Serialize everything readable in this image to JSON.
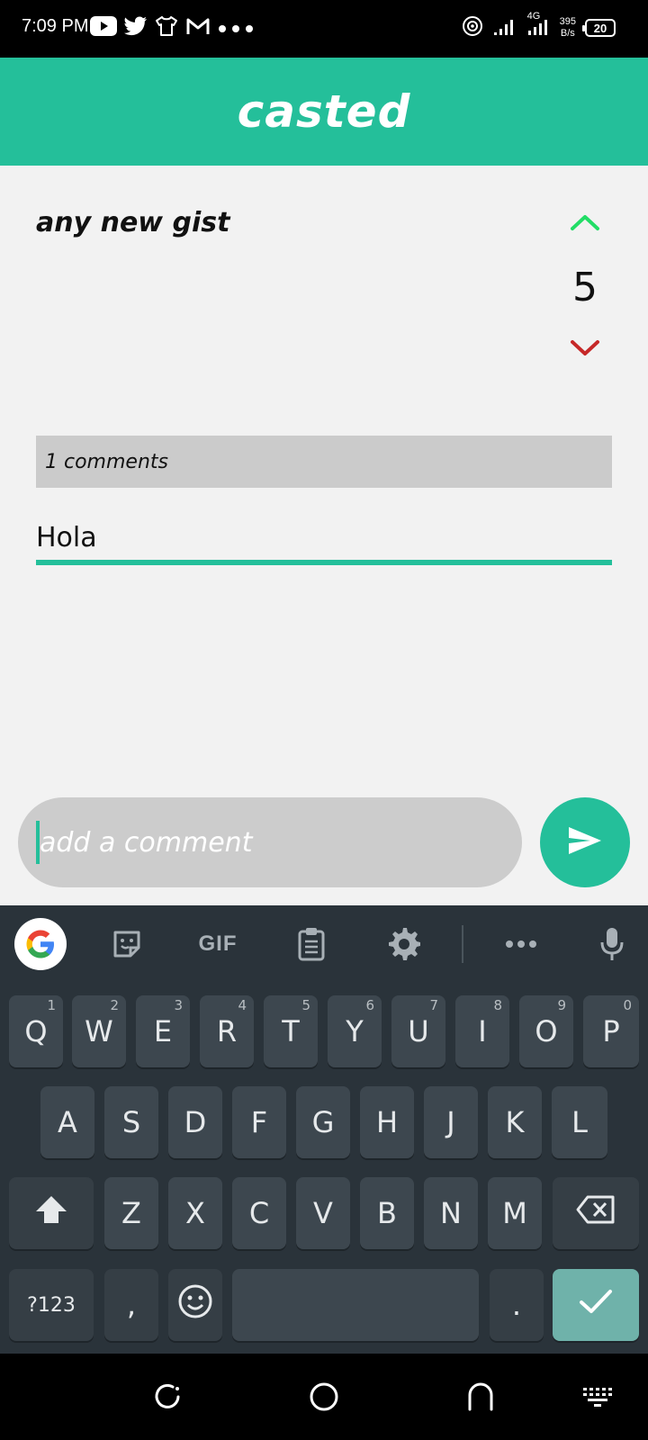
{
  "status_bar": {
    "time": "7:09 PM",
    "left_icons": [
      "youtube-icon",
      "twitter-icon",
      "shirt-icon",
      "gmail-icon",
      "more-dots-icon"
    ],
    "network_type": "4G",
    "speed_value": "395",
    "speed_unit": "B/s",
    "battery": "20"
  },
  "app_bar": {
    "title": "casted"
  },
  "post": {
    "title": "any new gist",
    "votes": "5",
    "upvote_color": "#22DD66",
    "downvote_color": "#C62828"
  },
  "comments": {
    "count_label": "1 comments",
    "items": [
      "Hola"
    ]
  },
  "composer": {
    "placeholder": "add a comment",
    "send_icon": "send-icon"
  },
  "keyboard": {
    "toolbar": {
      "gif_label": "GIF",
      "tools": [
        "google-icon",
        "sticker-icon",
        "gif",
        "clipboard-icon",
        "settings-gear-icon",
        "more-dots-icon",
        "microphone-icon"
      ]
    },
    "row1": [
      {
        "label": "Q",
        "hint": "1"
      },
      {
        "label": "W",
        "hint": "2"
      },
      {
        "label": "E",
        "hint": "3"
      },
      {
        "label": "R",
        "hint": "4"
      },
      {
        "label": "T",
        "hint": "5"
      },
      {
        "label": "Y",
        "hint": "6"
      },
      {
        "label": "U",
        "hint": "7"
      },
      {
        "label": "I",
        "hint": "8"
      },
      {
        "label": "O",
        "hint": "9"
      },
      {
        "label": "P",
        "hint": "0"
      }
    ],
    "row2": [
      "A",
      "S",
      "D",
      "F",
      "G",
      "H",
      "J",
      "K",
      "L"
    ],
    "row3": [
      "Z",
      "X",
      "C",
      "V",
      "B",
      "N",
      "M"
    ],
    "symbols_label": "?123",
    "comma_label": ",",
    "period_label": ".",
    "accent_color": "#6FB2AA"
  },
  "nav_bar": {
    "items": [
      "recents-icon",
      "home-icon",
      "back-icon",
      "keyboard-switch-icon"
    ]
  },
  "colors": {
    "brand": "#24BF9A",
    "content_bg": "#F2F2F2",
    "keyboard_bg": "#2A333A"
  }
}
